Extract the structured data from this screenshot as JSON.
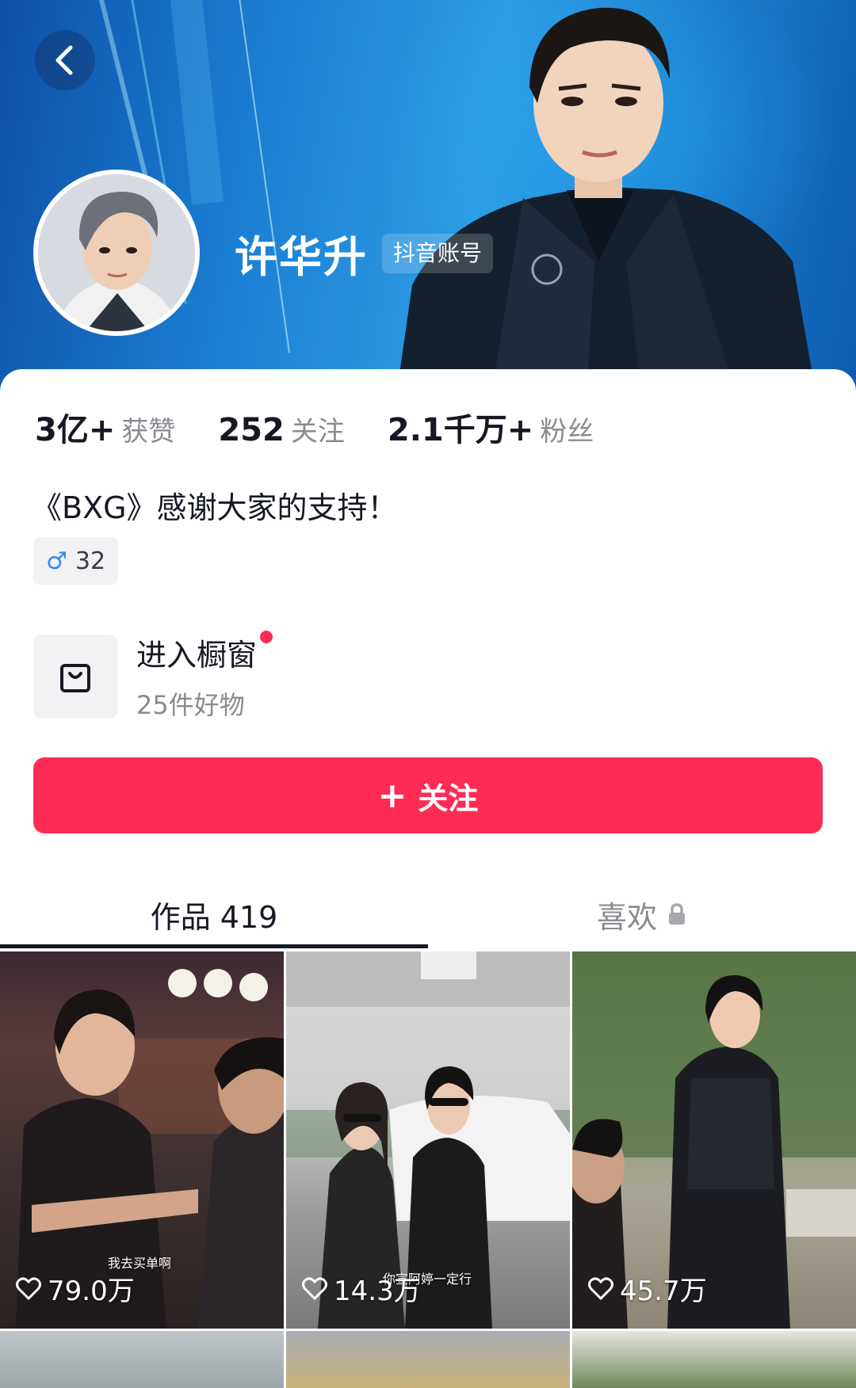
{
  "header": {
    "name": "许华升",
    "account_tag": "抖音账号"
  },
  "stats": [
    {
      "value": "3亿+",
      "label": "获赞"
    },
    {
      "value": "252",
      "label": "关注"
    },
    {
      "value": "2.1千万+",
      "label": "粉丝"
    }
  ],
  "bio": "《BXG》感谢大家的支持！",
  "gender_age": "32",
  "shop": {
    "title": "进入橱窗",
    "subtitle": "25件好物"
  },
  "follow_button": "关注",
  "tabs": [
    {
      "label": "作品 419"
    },
    {
      "label": "喜欢"
    }
  ],
  "videos": [
    {
      "likes": "79.0万",
      "caption": "我去买单啊"
    },
    {
      "likes": "14.3万",
      "caption": "你宣阿婷一定行"
    },
    {
      "likes": "45.7万",
      "caption": ""
    }
  ],
  "colors": {
    "accent": "#fe2c55",
    "banner": "#1b7fd4"
  }
}
